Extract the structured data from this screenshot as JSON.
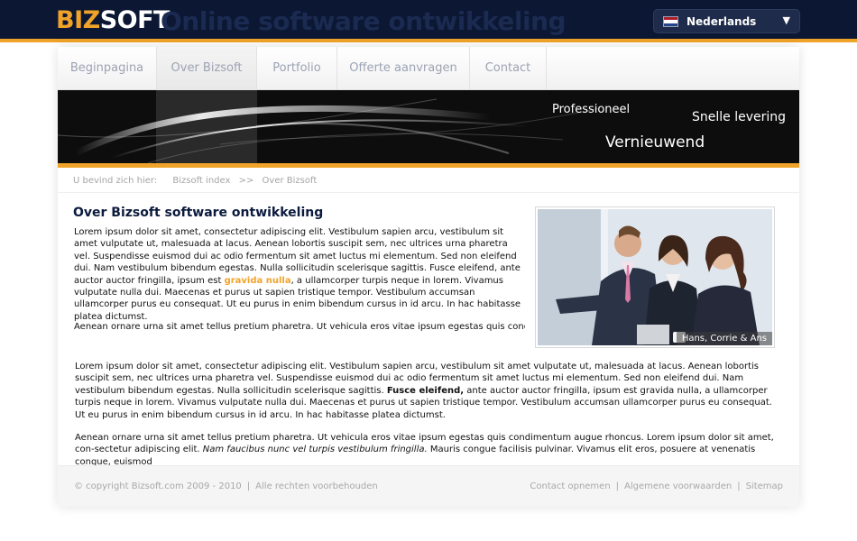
{
  "brand": {
    "biz": "BIZ",
    "soft": "SOFT",
    "tagline": "Online software ontwikkeling"
  },
  "language": {
    "selected": "Nederlands",
    "arrow": "▼"
  },
  "nav": {
    "items": [
      {
        "label": "Beginpagina"
      },
      {
        "label": "Over Bizsoft"
      },
      {
        "label": "Portfolio"
      },
      {
        "label": "Offerte aanvragen"
      },
      {
        "label": "Contact"
      }
    ]
  },
  "banner": {
    "line1": "Professioneel",
    "line2": "Snelle levering",
    "line3": "Vernieuwend"
  },
  "breadcrumb": {
    "label": "U bevind zich hier:",
    "item1": "Bizsoft index",
    "sep": ">>",
    "item2": "Over Bizsoft"
  },
  "content": {
    "title": "Over Bizsoft software ontwikkeling",
    "intro_a": "Lorem ipsum dolor sit amet, consectetur adipiscing elit. Vestibulum sapien arcu, vestibulum sit amet vulputate ut, malesuada at lacus. Aenean lobortis suscipit sem, nec ultrices urna pharetra vel. Suspendisse euismod dui ac odio fermentum sit amet luctus mi elementum. Sed non eleifend dui. Nam vestibulum bibendum egestas. Nulla sollicitudin scelerisque sagittis. Fusce eleifend, ante auctor auctor fringilla, ipsum est ",
    "intro_highlight": "gravida nulla",
    "intro_b": ", a ullamcorper turpis neque in lorem. Vivamus vulputate nulla dui. Maecenas et purus ut sapien tristique tempor. Vestibulum accumsan ullamcorper purus eu consequat. Ut eu purus in enim bibendum cursus in id arcu. In hac habitasse platea dictumst.",
    "intro2": "Aenean ornare urna sit amet tellus pretium pharetra. Ut vehicula eros vitae ipsum egestas quis condi-",
    "photo_caption": "Hans, Corrie & Ans",
    "body1_a": "Lorem ipsum dolor sit amet, consectetur adipiscing elit. Vestibulum sapien arcu, vestibulum sit amet vulputate ut, malesuada at lacus. Aenean lobortis suscipit sem, nec ultrices urna pharetra vel. Suspendisse euismod dui ac odio fermentum sit amet luctus mi elementum. Sed non eleifend dui. Nam vestibulum bibendum egestas. Nulla sollicitudin scelerisque sagittis. ",
    "body1_bold": "Fusce eleifend,",
    "body1_b": " ante auctor auctor fringilla, ipsum est gravida nulla, a ullamcorper turpis neque in lorem. Vivamus vulputate nulla dui. Maecenas et purus ut sapien tristique tempor. Vestibulum accumsan ullamcorper purus eu consequat. Ut eu purus in enim bibendum cursus in id arcu. In hac habitasse platea dictumst.",
    "body2_a": "Aenean ornare urna sit amet tellus pretium pharetra. Ut vehicula eros vitae ipsum egestas quis condimentum augue rhoncus. Lorem ipsum dolor sit amet, con-sectetur adipiscing elit. ",
    "body2_italic": "Nam faucibus nunc vel turpis vestibulum fringilla.",
    "body2_b": " Mauris congue facilisis pulvinar. Vivamus elit eros, posuere at venenatis congue, euismod"
  },
  "footer": {
    "copyright": "© copyright Bizsoft.com 2009 - 2010",
    "rights": "Alle rechten voorbehouden",
    "sep": "|",
    "links": [
      "Contact opnemen",
      "Algemene voorwaarden",
      "Sitemap"
    ]
  },
  "colors": {
    "navy": "#0b1733",
    "accent": "#f0a329",
    "flag_red": "#ae1c28",
    "flag_white": "#ffffff",
    "flag_blue": "#21468b"
  }
}
